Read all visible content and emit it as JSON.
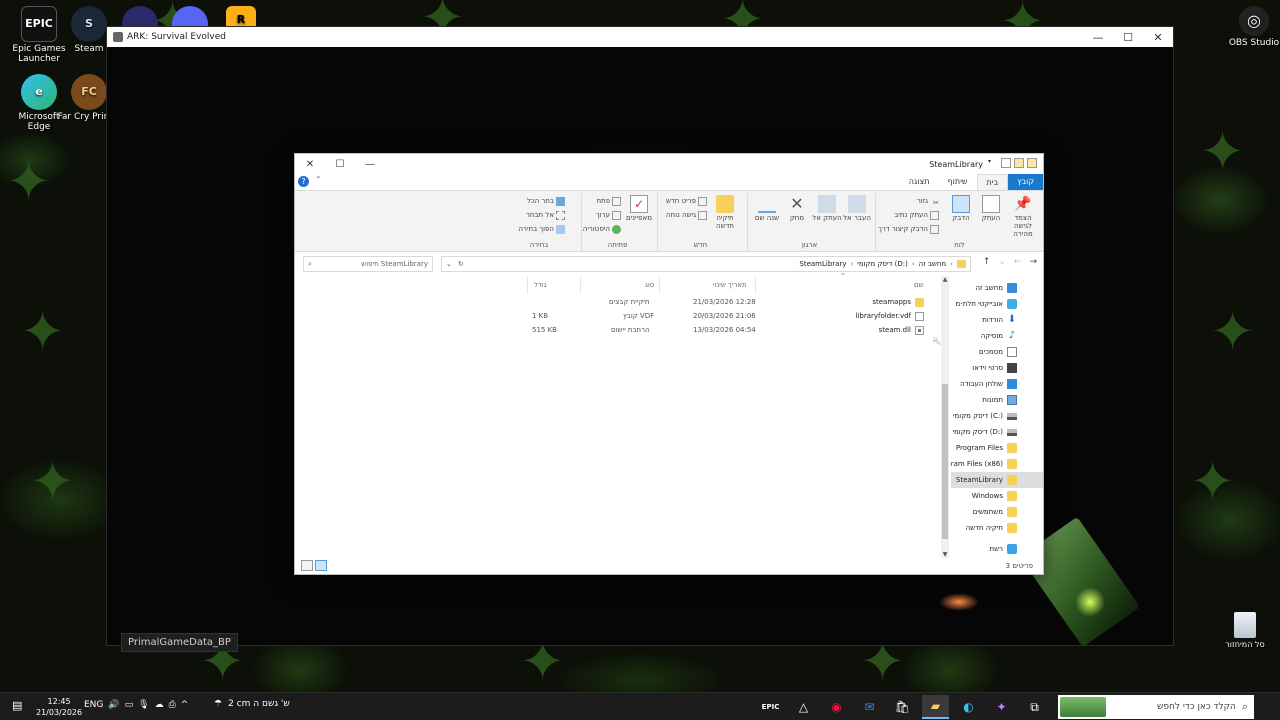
{
  "desktop": {
    "icons": [
      {
        "label": "Epic Games Launcher",
        "glyph": "EPIC"
      },
      {
        "label": "Steam",
        "glyph": "S"
      },
      {
        "label": "Microsoft Edge",
        "glyph": "e"
      },
      {
        "label": "Far Cry Primal",
        "glyph": "FC"
      },
      {
        "label": "OBS Studio",
        "glyph": "◎"
      }
    ],
    "recycle_bin_label": "סל המיחזור"
  },
  "ark_window": {
    "title": "ARK: Survival Evolved",
    "overlay_label": "PrimalGameData_BP"
  },
  "explorer": {
    "title": "SteamLibrary",
    "tabs": {
      "file": "קובץ",
      "home": "בית",
      "share": "שיתוף",
      "view": "תצוגה"
    },
    "ribbon": {
      "clipboard": {
        "group": "לוח",
        "pin_quick_access": "הצמד לגישה מהירה",
        "copy": "העתק",
        "paste": "הדבק",
        "cut": "גזור",
        "copy_path": "העתק נתיב",
        "paste_shortcut": "הדבק קיצור דרך"
      },
      "organize": {
        "group": "ארגון",
        "move_to": "העבר אל",
        "copy_to": "העתק אל",
        "delete": "מחק",
        "rename": "שנה שם"
      },
      "new": {
        "group": "חדש",
        "new_folder": "תיקיה חדשה",
        "new_item": "פריט חדש",
        "easy_access": "גישה נוחה"
      },
      "open": {
        "group": "פתיחה",
        "properties": "מאפיינים",
        "open": "פתח",
        "edit": "ערוך",
        "history": "היסטוריה"
      },
      "select": {
        "group": "בחירה",
        "select_all": "בחר הכל",
        "select_none": "אל תבחר",
        "invert": "הפוך בחירה"
      }
    },
    "address": {
      "crumbs": [
        "מחשב זה",
        "דיסק מקומי (D:)",
        "SteamLibrary"
      ],
      "search_placeholder": "חיפוש SteamLibrary"
    },
    "columns": {
      "name": "שם",
      "date": "תאריך שינוי",
      "type": "סוג",
      "size": "גודל"
    },
    "files": [
      {
        "name": "steamapps",
        "date": "21/03/2026 12:28",
        "type": "תיקיית קבצים",
        "size": "",
        "icon": "folder-icon"
      },
      {
        "name": "libraryfolder.vdf",
        "date": "20/03/2026 21:06",
        "type": "קובץ VDF",
        "size": "1 KB",
        "icon": "file-icon"
      },
      {
        "name": "steam.dll",
        "date": "13/03/2026 04:54",
        "type": "הרחבת יישום",
        "size": "515 KB",
        "icon": "dll-icon"
      }
    ],
    "nav": [
      {
        "label": "מחשב זה",
        "icon": "pc"
      },
      {
        "label": "אובייקטי תלת-מ",
        "icon": "cube"
      },
      {
        "label": "הורדות",
        "icon": "down"
      },
      {
        "label": "מוסיקה",
        "icon": "music"
      },
      {
        "label": "מסמכים",
        "icon": "doc"
      },
      {
        "label": "סרטי וידאו",
        "icon": "video"
      },
      {
        "label": "שולחן העבודה",
        "icon": "desk"
      },
      {
        "label": "תמונות",
        "icon": "pic"
      },
      {
        "label": "דיסק מקומי (C:)",
        "icon": "drive"
      },
      {
        "label": "דיסק מקומי (D:)",
        "icon": "drive"
      },
      {
        "label": "Program Files",
        "icon": "folder"
      },
      {
        "label": "ram Files (x86)",
        "icon": "folder"
      },
      {
        "label": "SteamLibrary",
        "icon": "folder"
      },
      {
        "label": "Windows",
        "icon": "folder"
      },
      {
        "label": "משתמשים",
        "icon": "folder"
      },
      {
        "label": "תיקיה חדשה",
        "icon": "folder"
      },
      {
        "label": "רשת",
        "icon": "net"
      }
    ],
    "status": "3 פריטים"
  },
  "taskbar": {
    "search_placeholder": "הקלד כאן כדי לחפש",
    "weather": "2 cm ש' גשם ה",
    "time": "12:45",
    "date": "21/03/2026",
    "lang": "ENG"
  },
  "colors": {
    "ribbon_file_tab": "#1979ca",
    "folder": "#f7d05a",
    "selection": "#dddddd"
  }
}
